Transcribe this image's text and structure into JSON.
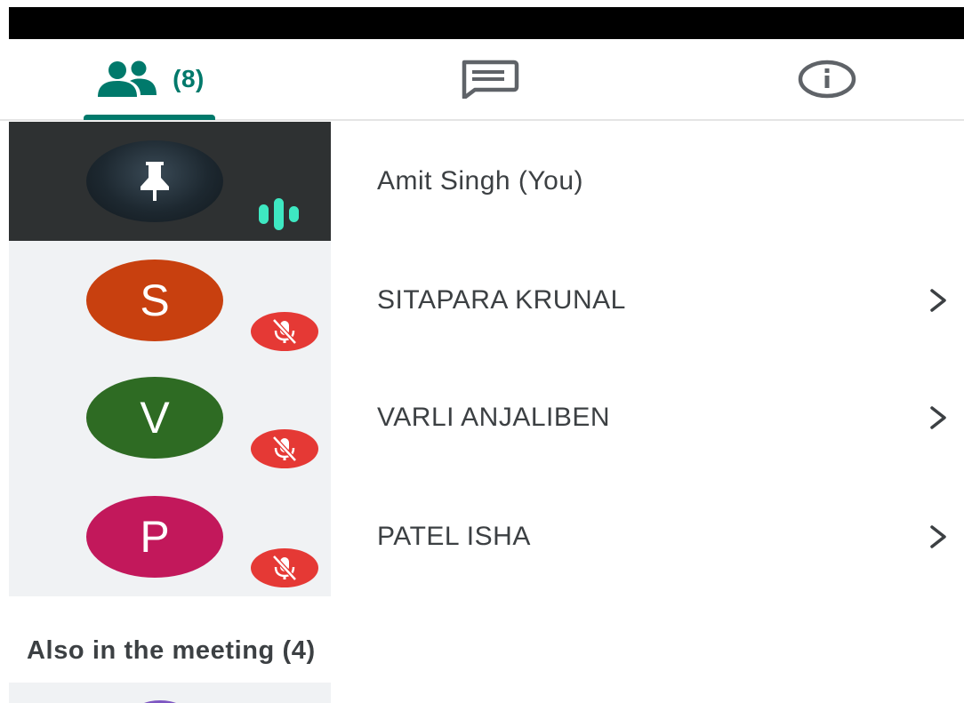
{
  "tabs": {
    "people": {
      "icon": "people-icon",
      "count": "(8)"
    },
    "chat": {
      "icon": "chat-icon"
    },
    "info": {
      "icon": "info-icon"
    }
  },
  "colors": {
    "accent": "#00796b",
    "mute_badge": "#e53935",
    "speaking": "#3ee8c2"
  },
  "participants": [
    {
      "name": "Amit Singh (You)",
      "avatar": "photo",
      "status": "speaking-icon"
    },
    {
      "name": "SITAPARA KRUNAL",
      "initial": "S",
      "avatar_color": "#c8400f",
      "status": "mic-off-icon"
    },
    {
      "name": "VARLI ANJALIBEN",
      "initial": "V",
      "avatar_color": "#2e6b23",
      "status": "mic-off-icon"
    },
    {
      "name": "PATEL ISHA",
      "initial": "P",
      "avatar_color": "#c2185b",
      "status": "mic-off-icon"
    }
  ],
  "also_in_meeting": {
    "title": "Also in the meeting (4)"
  }
}
